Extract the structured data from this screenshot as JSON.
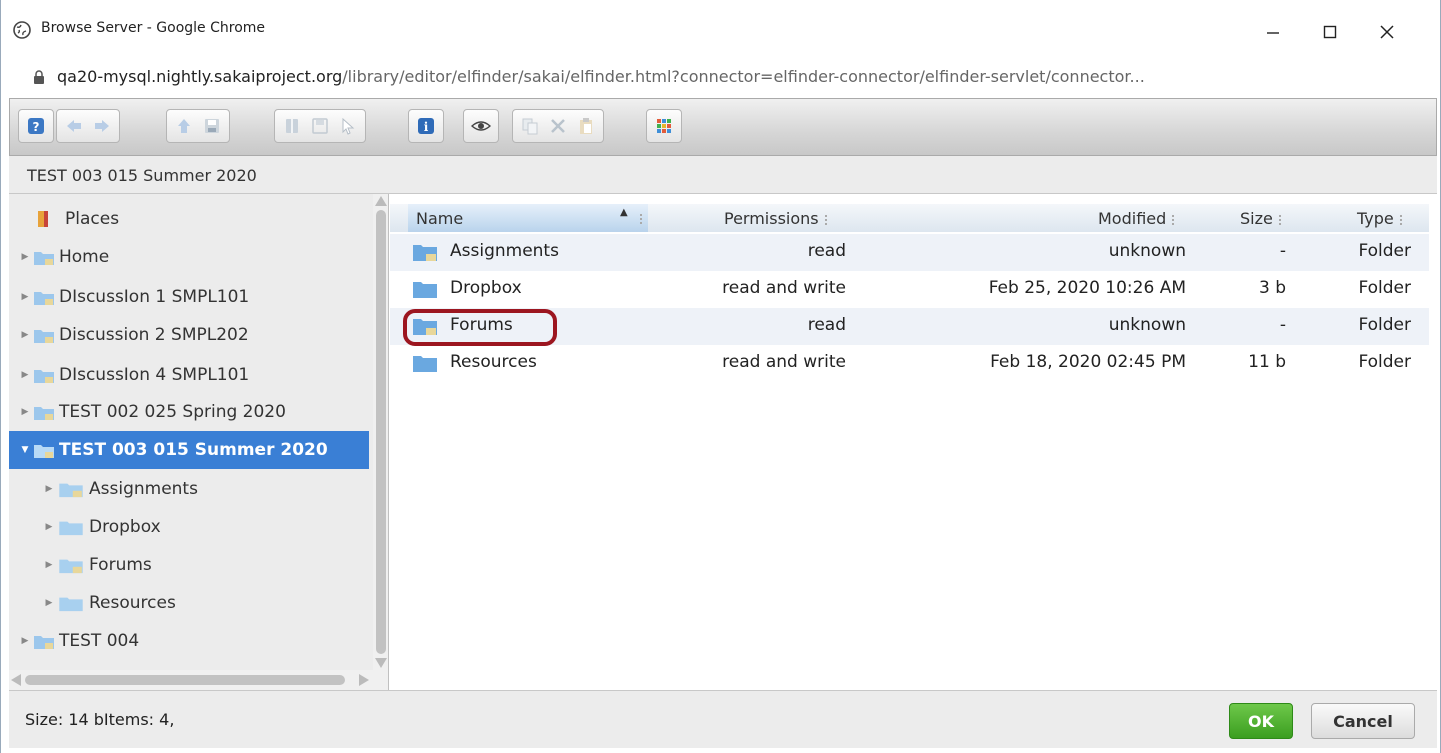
{
  "window": {
    "title": "Browse Server - Google Chrome",
    "url_host": "qa20-mysql.nightly.sakaiproject.org",
    "url_path": "/library/editor/elfinder/sakai/elfinder.html?connector=elfinder-connector/elfinder-servlet/connector..."
  },
  "path": "TEST 003 015 Summer 2020",
  "tree": {
    "places": "Places",
    "items": [
      {
        "label": "Home"
      },
      {
        "label": "DIscussIon 1 SMPL101"
      },
      {
        "label": "Discussion 2 SMPL202"
      },
      {
        "label": "DIscussIon 4 SMPL101"
      },
      {
        "label": "TEST 002 025 Spring 2020"
      },
      {
        "label": "TEST 003 015 Summer 2020"
      },
      {
        "label": "Assignments"
      },
      {
        "label": "Dropbox"
      },
      {
        "label": "Forums"
      },
      {
        "label": "Resources"
      },
      {
        "label": "TEST 004"
      }
    ]
  },
  "list": {
    "headers": {
      "name": "Name",
      "permissions": "Permissions",
      "modified": "Modified",
      "size": "Size",
      "type": "Type"
    },
    "rows": [
      {
        "name": "Assignments",
        "permissions": "read",
        "modified": "unknown",
        "size": "-",
        "type": "Folder"
      },
      {
        "name": "Dropbox",
        "permissions": "read and write",
        "modified": "Feb 25, 2020 10:26 AM",
        "size": "3 b",
        "type": "Folder"
      },
      {
        "name": "Forums",
        "permissions": "read",
        "modified": "unknown",
        "size": "-",
        "type": "Folder"
      },
      {
        "name": "Resources",
        "permissions": "read and write",
        "modified": "Feb 18, 2020 02:45 PM",
        "size": "11 b",
        "type": "Folder"
      }
    ]
  },
  "status": {
    "text": "Size: 14 bItems: 4,"
  },
  "buttons": {
    "ok": "OK",
    "cancel": "Cancel"
  },
  "colors": {
    "accent": "#3a7fd5",
    "highlight": "#9c1620",
    "ok": "#4caf2a"
  }
}
